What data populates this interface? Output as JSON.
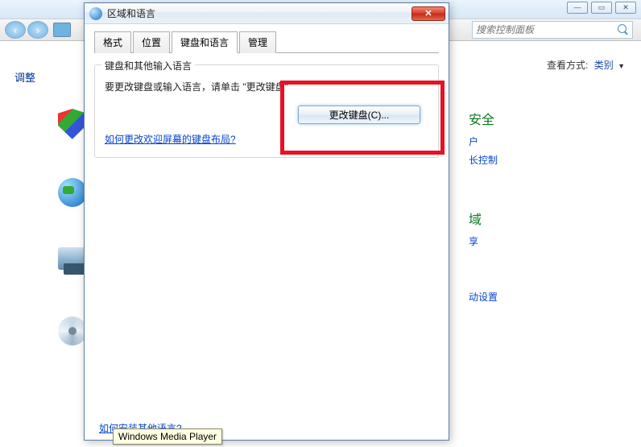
{
  "bg": {
    "search_placeholder": "搜索控制面板",
    "adjust_label": "调整",
    "view_label": "查看方式:",
    "view_value": "类别",
    "cats": {
      "security_head": "安全",
      "security_l1": "户",
      "security_l2": "长控制",
      "network_head": "域",
      "network_l1": "享",
      "settings_l1": "动设置"
    }
  },
  "dialog": {
    "title": "区域和语言",
    "tabs": [
      "格式",
      "位置",
      "键盘和语言",
      "管理"
    ],
    "group_title": "键盘和其他输入语言",
    "instruction": "要更改键盘或输入语言，请单击 \"更改键盘\"",
    "change_btn": "更改键盘(C)...",
    "help_link": "如何更改欢迎屏幕的键盘布局?",
    "bottom_link": "如何安装其他语言?"
  },
  "tooltip": "Windows Media Player"
}
